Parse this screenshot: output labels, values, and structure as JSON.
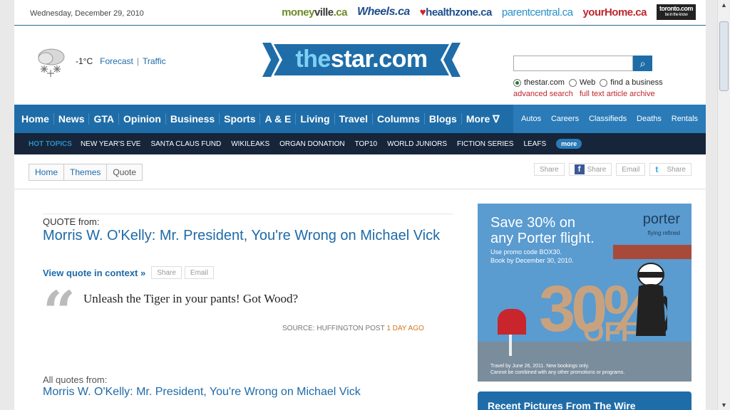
{
  "topbar": {
    "date": "Wednesday, December 29, 2010",
    "partners": {
      "moneyville_a": "money",
      "moneyville_b": "ville",
      "moneyville_c": ".ca",
      "wheels": "Wheels.ca",
      "healthzone": "healthzone.ca",
      "parentcentral": "parentcentral.ca",
      "yourhome": "yourHome.ca",
      "toronto": "toronto.com",
      "toronto_tag": "be in the know"
    }
  },
  "header": {
    "weather": {
      "temp": "-1°C",
      "forecast": "Forecast",
      "separator": "|",
      "traffic": "Traffic"
    },
    "logo": {
      "the": "the",
      "rest": "star.com"
    },
    "search": {
      "button_glyph": "⌕",
      "options": [
        "thestar.com",
        "Web",
        "find a business"
      ],
      "advanced": "advanced search",
      "archive": "full text article archive"
    }
  },
  "nav": {
    "main": [
      "Home",
      "News",
      "GTA",
      "Opinion",
      "Business",
      "Sports",
      "A & E",
      "Living",
      "Travel",
      "Columns",
      "Blogs",
      "More ∇"
    ],
    "right": [
      "Autos",
      "Careers",
      "Classifieds",
      "Deaths",
      "Rentals"
    ]
  },
  "hot_topics": {
    "label": "HOT TOPICS",
    "items": [
      "NEW YEAR'S EVE",
      "SANTA CLAUS FUND",
      "WIKILEAKS",
      "ORGAN DONATION",
      "TOP10",
      "WORLD JUNIORS",
      "FICTION SERIES",
      "LEAFS"
    ],
    "more": "more"
  },
  "breadcrumb": [
    "Home",
    "Themes",
    "Quote"
  ],
  "share_top": [
    "Share",
    "Share",
    "Email",
    "Share"
  ],
  "quote": {
    "from_label": "QUOTE from:",
    "title": "Morris W. O'Kelly: Mr. President, You're Wrong on Michael Vick",
    "view_context": "View quote in context »",
    "share": "Share",
    "email": "Email",
    "mark": "“",
    "text": "Unleash the Tiger in your pants! Got Wood?",
    "source_label": "SOURCE: HUFFINGTON POST",
    "source_time": "1 DAY AGO",
    "all_label": "All quotes from:",
    "all_link": "Morris W. O'Kelly: Mr. President, You're Wrong on Michael Vick"
  },
  "ad": {
    "headline_1": "Save 30% on",
    "headline_2": "any Porter flight.",
    "brand": "porter",
    "brand_tag": "flying refined",
    "promo_1": "Use promo code BOX30.",
    "promo_2": "Book by December 30, 2010.",
    "big": "30%",
    "off": "OFF",
    "fine_1": "Travel by June 26, 2011. New bookings only.",
    "fine_2": "Cannot be combined with any other promotions or programs."
  },
  "wire": {
    "title": "Recent Pictures From The Wire"
  },
  "colors": {
    "brand_blue": "#1f6da8",
    "dark_bar": "#16253a",
    "link": "#1e6aa8",
    "alert_red": "#c0262c",
    "ad_blue": "#5a9bd0"
  }
}
